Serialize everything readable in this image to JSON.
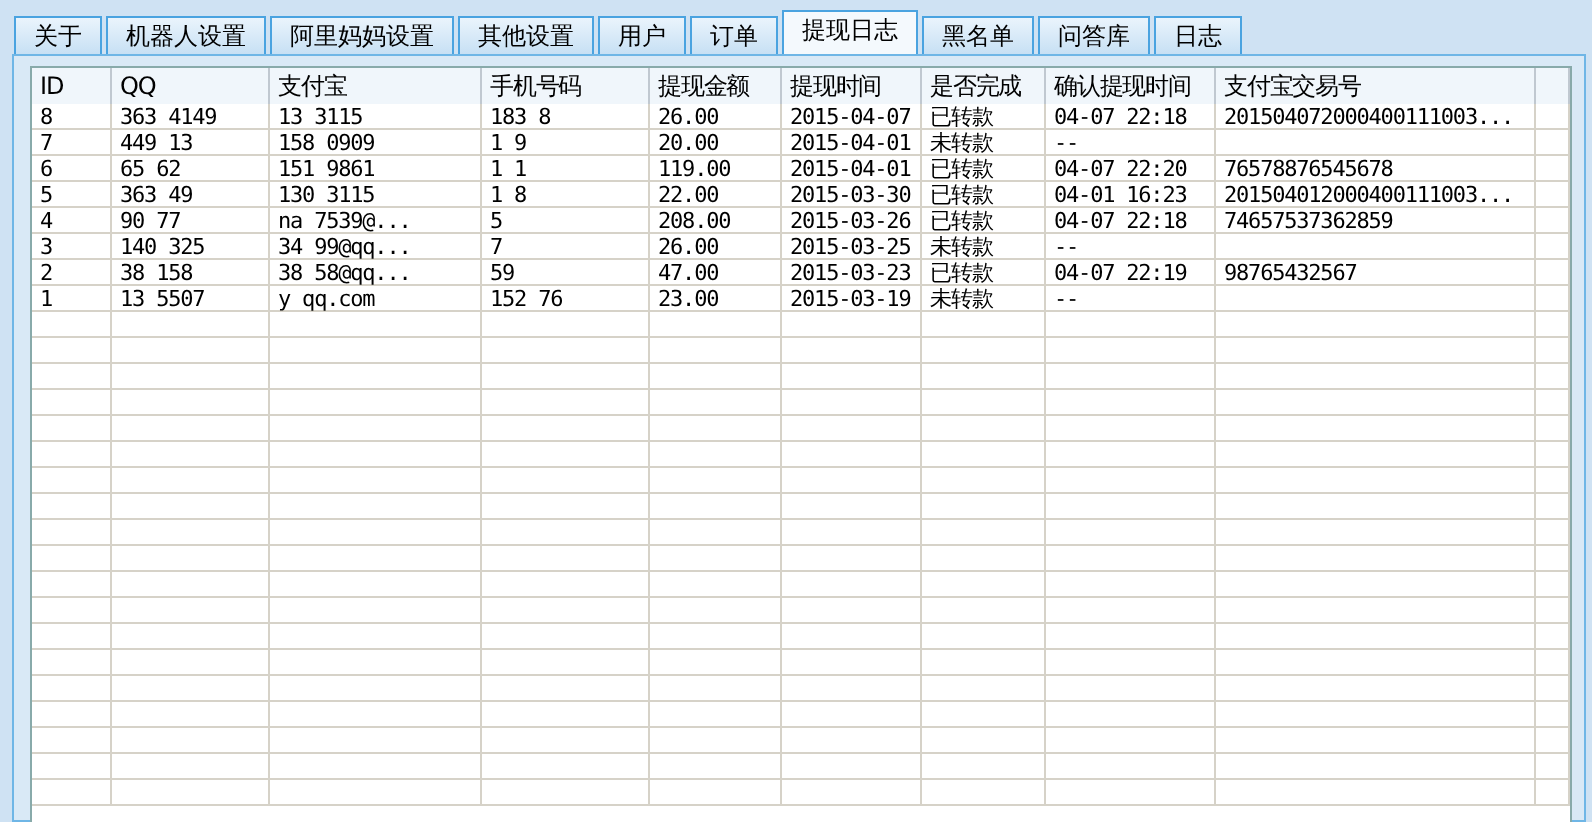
{
  "tabs": [
    {
      "label": "关于",
      "selected": false
    },
    {
      "label": "机器人设置",
      "selected": false
    },
    {
      "label": "阿里妈妈设置",
      "selected": false
    },
    {
      "label": "其他设置",
      "selected": false
    },
    {
      "label": "用户",
      "selected": false
    },
    {
      "label": "订单",
      "selected": false
    },
    {
      "label": "提现日志",
      "selected": true
    },
    {
      "label": "黑名单",
      "selected": false
    },
    {
      "label": "问答库",
      "selected": false
    },
    {
      "label": "日志",
      "selected": false
    }
  ],
  "table": {
    "columns": [
      "ID",
      "QQ",
      "支付宝",
      "手机号码",
      "提现金额",
      "提现时间",
      "是否完成",
      "确认提现时间",
      "支付宝交易号"
    ],
    "rows": [
      [
        "8",
        "363 4149",
        "13 3115",
        "183 8",
        "26.00",
        "2015-04-07",
        "已转款",
        "04-07 22:18",
        "201504072000400111003..."
      ],
      [
        "7",
        "449 13",
        "158 0909",
        "1 9",
        "20.00",
        "2015-04-01",
        "未转款",
        "--",
        ""
      ],
      [
        "6",
        "65 62",
        "151 9861",
        "1 1",
        "119.00",
        "2015-04-01",
        "已转款",
        "04-07 22:20",
        "76578876545678"
      ],
      [
        "5",
        "363 49",
        "130 3115",
        "1 8",
        "22.00",
        "2015-03-30",
        "已转款",
        "04-01 16:23",
        "201504012000400111003..."
      ],
      [
        "4",
        "90 77",
        "na 7539@...",
        "5",
        "208.00",
        "2015-03-26",
        "已转款",
        "04-07 22:18",
        "74657537362859"
      ],
      [
        "3",
        "140 325",
        "34 99@qq...",
        "7",
        "26.00",
        "2015-03-25",
        "未转款",
        "--",
        ""
      ],
      [
        "2",
        "38 158",
        "38 58@qq...",
        "59",
        "47.00",
        "2015-03-23",
        "已转款",
        "04-07 22:19",
        "98765432567"
      ],
      [
        "1",
        "13 5507",
        "y qq.com",
        "152 76",
        "23.00",
        "2015-03-19",
        "未转款",
        "--",
        ""
      ]
    ]
  }
}
